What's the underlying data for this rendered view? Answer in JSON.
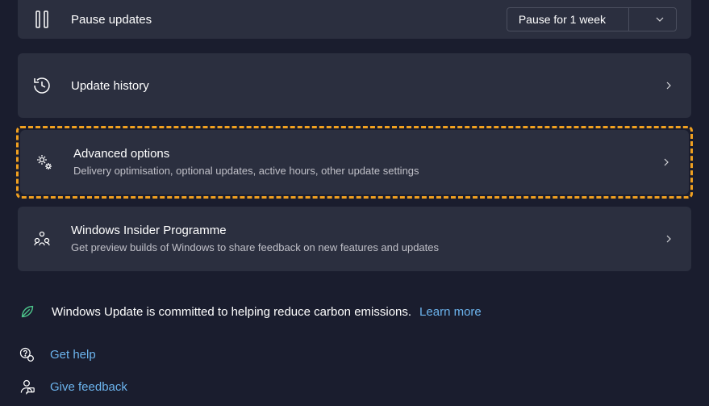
{
  "pause": {
    "label": "Pause updates",
    "dropdown_value": "Pause for 1 week"
  },
  "history": {
    "title": "Update history"
  },
  "advanced": {
    "title": "Advanced options",
    "subtitle": "Delivery optimisation, optional updates, active hours, other update settings"
  },
  "insider": {
    "title": "Windows Insider Programme",
    "subtitle": "Get preview builds of Windows to share feedback on new features and updates"
  },
  "carbon": {
    "text": "Windows Update is committed to helping reduce carbon emissions.",
    "link": "Learn more"
  },
  "help": {
    "text": "Get help"
  },
  "feedback": {
    "text": "Give feedback"
  }
}
